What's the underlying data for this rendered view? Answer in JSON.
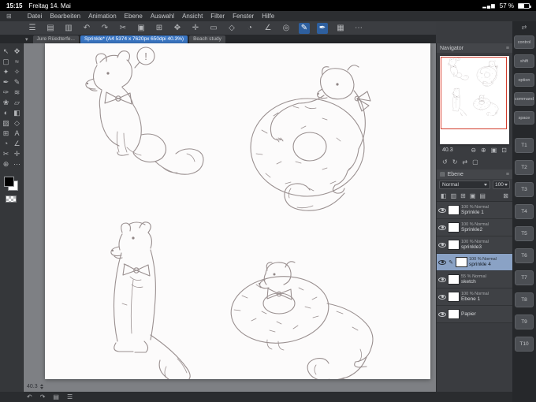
{
  "status_bar": {
    "time": "15:15",
    "date": "Freitag 14. Mai",
    "battery_percent": "57 %",
    "signal_glyph": "▂▄▆"
  },
  "glyphs": {
    "app_menu": "⊞",
    "tab_list": "▾",
    "nav_panel_menu": "≡",
    "layers_panel_tab": "▤",
    "layers_panel_menu": "≡",
    "edge_toggle": "⇄"
  },
  "menu_bar": {
    "items": [
      "Datei",
      "Bearbeiten",
      "Animation",
      "Ebene",
      "Auswahl",
      "Ansicht",
      "Filter",
      "Fenster",
      "Hilfe"
    ]
  },
  "toolbar": {
    "icons": [
      {
        "name": "main-menu-icon",
        "glyph": "☰"
      },
      {
        "name": "new-canvas-icon",
        "glyph": "▤"
      },
      {
        "name": "save-icon",
        "glyph": "▥"
      },
      {
        "name": "undo-icon",
        "glyph": "↶"
      },
      {
        "name": "redo-icon",
        "glyph": "↷"
      },
      {
        "name": "cut-icon",
        "glyph": "✂"
      },
      {
        "name": "copy-icon",
        "glyph": "▣"
      },
      {
        "name": "paste-icon",
        "glyph": "⊞"
      },
      {
        "name": "transform-icon",
        "glyph": "✥"
      },
      {
        "name": "correction-icon",
        "glyph": "✛"
      },
      {
        "name": "selection-icon",
        "glyph": "▭"
      },
      {
        "name": "figure-icon",
        "glyph": "◇"
      },
      {
        "name": "fill-icon",
        "glyph": "◔"
      },
      {
        "name": "ruler-icon",
        "glyph": "∠"
      },
      {
        "name": "snap-icon",
        "glyph": "◎"
      },
      {
        "name": "pen-icon",
        "glyph": "✎",
        "active": true
      },
      {
        "name": "brush-icon",
        "glyph": "✒",
        "active": true
      },
      {
        "name": "grid-icon",
        "glyph": "▦"
      },
      {
        "name": "more-icon",
        "glyph": "⋯"
      }
    ]
  },
  "tab_bar": {
    "tabs": [
      {
        "label": "Jure Rüedterfe...",
        "active": false
      },
      {
        "label": "Sprinkle* (A4 5374 x 7620px 650dpi 40.3%)",
        "active": true
      },
      {
        "label": "Beach study",
        "active": false
      }
    ]
  },
  "tool_palette": {
    "tools": [
      {
        "name": "operation-tool-icon",
        "glyph": "↖"
      },
      {
        "name": "move-tool-icon",
        "glyph": "✥"
      },
      {
        "name": "marquee-tool-icon",
        "glyph": "▢"
      },
      {
        "name": "lasso-tool-icon",
        "glyph": "≈"
      },
      {
        "name": "wand-tool-icon",
        "glyph": "✦"
      },
      {
        "name": "eyedropper-tool-icon",
        "glyph": "✧"
      },
      {
        "name": "pen-tool-icon",
        "glyph": "✒"
      },
      {
        "name": "pencil-tool-icon",
        "glyph": "✎"
      },
      {
        "name": "brush-tool-icon",
        "glyph": "✑"
      },
      {
        "name": "airbrush-tool-icon",
        "glyph": "≋"
      },
      {
        "name": "decoration-tool-icon",
        "glyph": "❀"
      },
      {
        "name": "eraser-tool-icon",
        "glyph": "▱"
      },
      {
        "name": "blend-tool-icon",
        "glyph": "◐"
      },
      {
        "name": "fill-tool-icon",
        "glyph": "◧"
      },
      {
        "name": "gradient-tool-icon",
        "glyph": "▨"
      },
      {
        "name": "figure-tool-icon",
        "glyph": "◇"
      },
      {
        "name": "frame-tool-icon",
        "glyph": "⊞"
      },
      {
        "name": "text-tool-icon",
        "glyph": "A"
      },
      {
        "name": "balloon-tool-icon",
        "glyph": "◔"
      },
      {
        "name": "ruler-tool-icon",
        "glyph": "∠"
      },
      {
        "name": "scissors-tool-icon",
        "glyph": "✂"
      },
      {
        "name": "correction-tool-icon",
        "glyph": "✛"
      },
      {
        "name": "zoom-tool-icon",
        "glyph": "⊕"
      },
      {
        "name": "more-tools-icon",
        "glyph": "⋯"
      }
    ]
  },
  "canvas": {
    "bubble_text": "!",
    "zoom_readout": "40.3"
  },
  "navigator": {
    "title": "Navigator",
    "zoom_value": "40.3",
    "zoom_row": [
      {
        "name": "zoom-out-icon",
        "glyph": "⊖"
      },
      {
        "name": "zoom-in-icon",
        "glyph": "⊕"
      },
      {
        "name": "fit-screen-icon",
        "glyph": "▣"
      },
      {
        "name": "actual-size-icon",
        "glyph": "⊡"
      }
    ],
    "rotate_row": [
      {
        "name": "rotate-left-icon",
        "glyph": "↺"
      },
      {
        "name": "rotate-right-icon",
        "glyph": "↻"
      },
      {
        "name": "flip-horizontal-icon",
        "glyph": "⇄"
      },
      {
        "name": "reset-view-icon",
        "glyph": "▢"
      }
    ]
  },
  "layers": {
    "title": "Ebene",
    "blend_mode": "Normal",
    "opacity": "100",
    "toolbar_icons": [
      {
        "name": "clip-mask-icon",
        "glyph": "◧"
      },
      {
        "name": "lock-layer-icon",
        "glyph": "▥"
      },
      {
        "name": "new-layer-icon",
        "glyph": "⊞"
      },
      {
        "name": "new-folder-icon",
        "glyph": "▣"
      },
      {
        "name": "transfer-layer-icon",
        "glyph": "▤"
      },
      {
        "name": "delete-layer-icon",
        "glyph": "⊠",
        "last": true
      }
    ],
    "items": [
      {
        "meta": "100 % Normal",
        "name": "Sprinkle 1",
        "visible": true,
        "selected": false,
        "editing": false
      },
      {
        "meta": "100 % Normal",
        "name": "Sprinkle2",
        "visible": true,
        "selected": false,
        "editing": false
      },
      {
        "meta": "100 % Normal",
        "name": "sprinkle3",
        "visible": true,
        "selected": false,
        "editing": false
      },
      {
        "meta": "100 % Normal",
        "name": "sprinkle 4",
        "visible": true,
        "selected": true,
        "editing": true
      },
      {
        "meta": "55 % Normal",
        "name": "sketch",
        "visible": true,
        "selected": false,
        "editing": false
      },
      {
        "meta": "100 % Normal",
        "name": "Ebene 1",
        "visible": true,
        "selected": false,
        "editing": false
      },
      {
        "meta": "",
        "name": "Papier",
        "visible": true,
        "selected": false,
        "editing": false
      }
    ]
  },
  "edge_bar": {
    "modifiers": [
      {
        "name": "modifier-key-control",
        "label": "control"
      },
      {
        "name": "modifier-key-shift",
        "label": "shift"
      },
      {
        "name": "modifier-key-option",
        "label": "option"
      },
      {
        "name": "modifier-key-command",
        "label": "command"
      },
      {
        "name": "modifier-key-space",
        "label": "space"
      }
    ],
    "function_keys": [
      {
        "name": "touch-key-t1",
        "label": "T1"
      },
      {
        "name": "touch-key-t2",
        "label": "T2"
      },
      {
        "name": "touch-key-t3",
        "label": "T3"
      },
      {
        "name": "touch-key-t4",
        "label": "T4"
      },
      {
        "name": "touch-key-t5",
        "label": "T5"
      },
      {
        "name": "touch-key-t6",
        "label": "T6"
      },
      {
        "name": "touch-key-t7",
        "label": "T7"
      },
      {
        "name": "touch-key-t8",
        "label": "T8"
      },
      {
        "name": "touch-key-t9",
        "label": "T9"
      },
      {
        "name": "touch-key-t10",
        "label": "T10"
      }
    ]
  },
  "bottom_bar": {
    "icons": [
      {
        "name": "undo-bar-icon",
        "glyph": "↶"
      },
      {
        "name": "redo-bar-icon",
        "glyph": "↷"
      },
      {
        "name": "palette-bar-icon",
        "glyph": "▤"
      },
      {
        "name": "bar-menu-icon",
        "glyph": "☰"
      }
    ]
  }
}
